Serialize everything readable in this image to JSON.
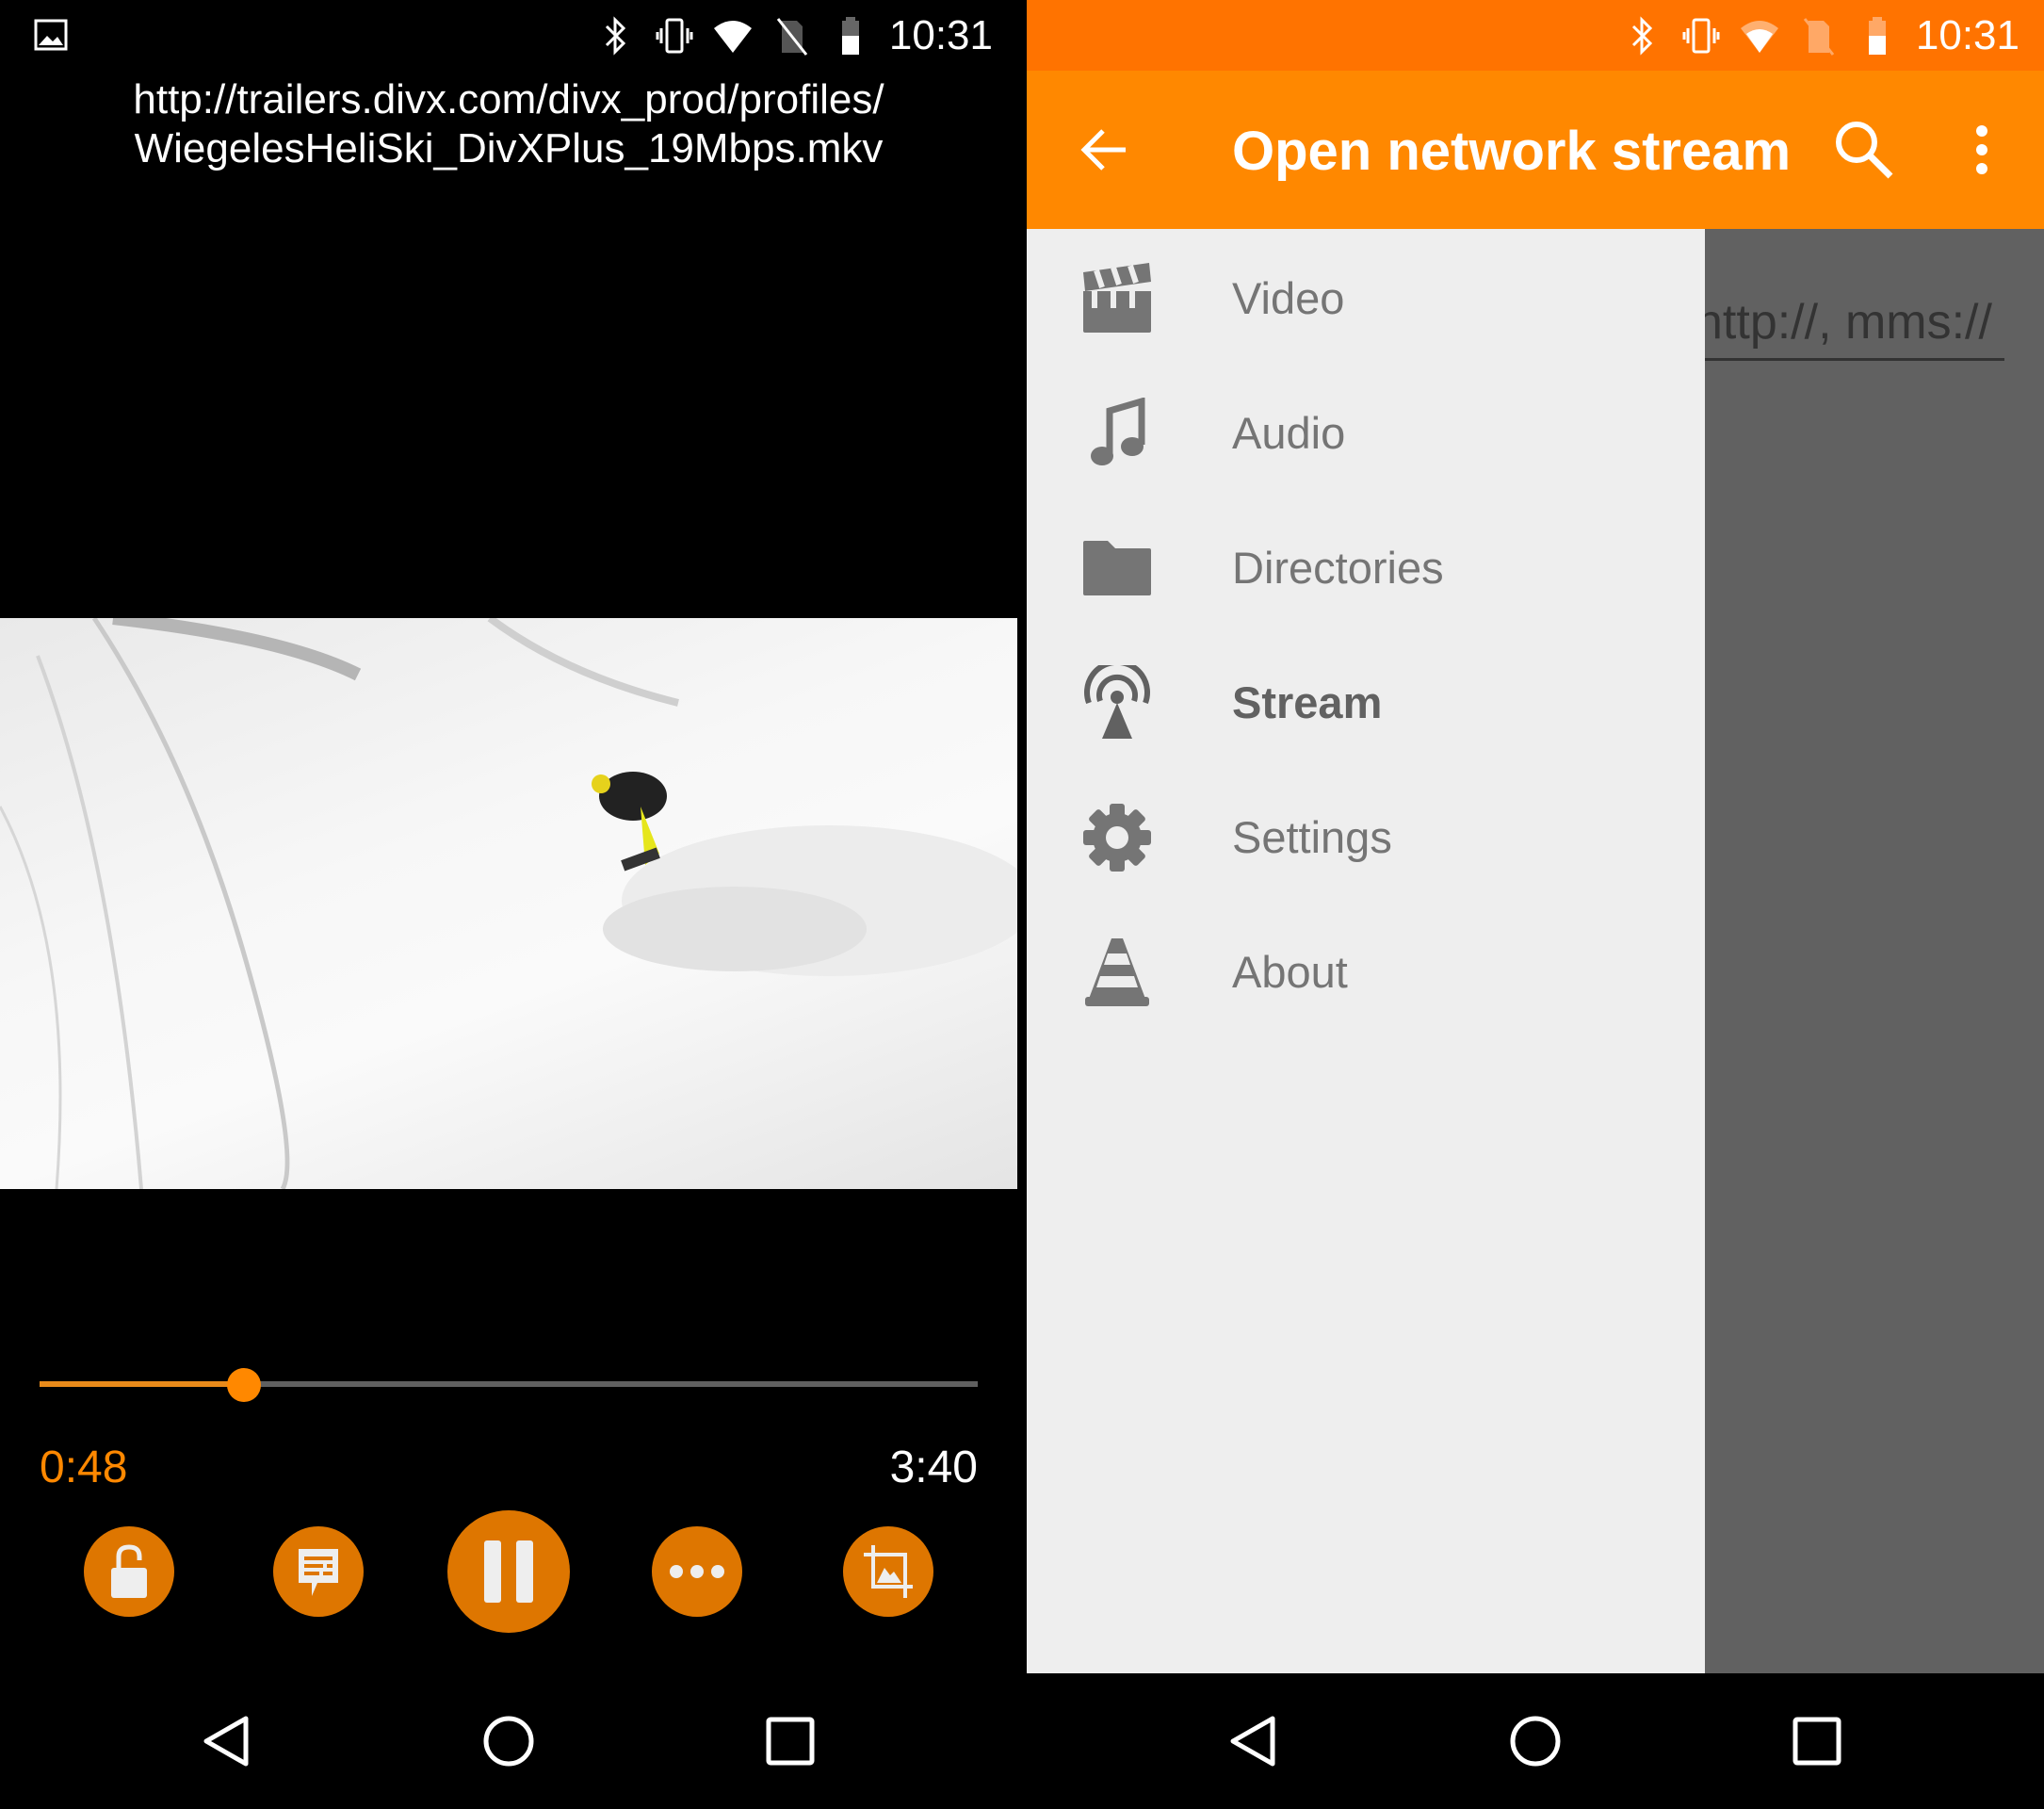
{
  "status_bar": {
    "time": "10:31",
    "icons": [
      "image-icon",
      "bluetooth-icon",
      "vibrate-icon",
      "wifi-icon",
      "no-sim-icon",
      "battery-icon"
    ]
  },
  "player": {
    "url_line1": "http://trailers.divx.com/divx_prod/profiles/",
    "url_line2": "WiegelesHeliSki_DivXPlus_19Mbps.mkv",
    "current_time": "0:48",
    "total_time": "3:40",
    "progress_fraction": 0.218,
    "controls": [
      "lock-icon",
      "subtitles-icon",
      "pause-icon",
      "more-icon",
      "crop-icon"
    ],
    "accent": "#ff8800"
  },
  "network": {
    "title": "Open network stream",
    "hint": "http://, mms://",
    "toolbar_color": "#ff8800",
    "status_color": "#ff7300",
    "menu": [
      {
        "label": "Video",
        "icon": "clapperboard-icon"
      },
      {
        "label": "Audio",
        "icon": "music-note-icon"
      },
      {
        "label": "Directories",
        "icon": "folder-icon"
      },
      {
        "label": "Stream",
        "icon": "antenna-icon",
        "selected": true
      },
      {
        "label": "Settings",
        "icon": "gear-icon"
      },
      {
        "label": "About",
        "icon": "vlc-cone-icon"
      }
    ]
  }
}
